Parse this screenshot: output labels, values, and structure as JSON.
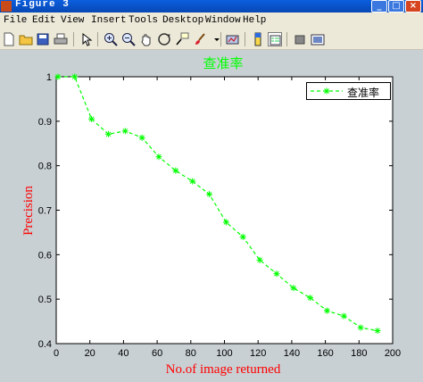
{
  "window": {
    "title": "Figure 3"
  },
  "menu": [
    "File",
    "Edit",
    "View",
    "Insert",
    "Tools",
    "Desktop",
    "Window",
    "Help"
  ],
  "toolbar_icons": [
    "new-figure-icon",
    "open-file-icon",
    "save-icon",
    "print-icon",
    "edit-plot-icon",
    "zoom-in-icon",
    "zoom-out-icon",
    "pan-icon",
    "rotate-3d-icon",
    "data-cursor-icon",
    "brush-icon",
    "link-plot-icon",
    "colorbar-icon",
    "legend-icon",
    "hide-plot-tools-icon",
    "show-plot-tools-icon"
  ],
  "colors": {
    "series": "#00ff00",
    "axis_label": "#ff0000",
    "title": "#00ff00",
    "figure_bg": "#c8d0d4"
  },
  "chart_data": {
    "type": "line",
    "title": "查准率",
    "xlabel": "No.of image returned",
    "ylabel": "Precision",
    "xlim": [
      0,
      200
    ],
    "ylim": [
      0.4,
      1.0
    ],
    "xticks": [
      "0",
      "20",
      "40",
      "60",
      "80",
      "100",
      "120",
      "140",
      "160",
      "180",
      "200"
    ],
    "yticks": [
      "0.4",
      "0.5",
      "0.6",
      "0.7",
      "0.8",
      "0.9",
      "1"
    ],
    "grid": false,
    "legend_position": "top-right",
    "series": [
      {
        "name": "查准率",
        "style": "dashed line, star markers",
        "x": [
          1,
          11,
          21,
          31,
          41,
          51,
          61,
          71,
          81,
          91,
          101,
          111,
          121,
          131,
          141,
          151,
          161,
          171,
          181,
          191
        ],
        "y": [
          1.0,
          1.0,
          0.905,
          0.871,
          0.878,
          0.863,
          0.82,
          0.789,
          0.765,
          0.736,
          0.673,
          0.64,
          0.588,
          0.557,
          0.525,
          0.503,
          0.474,
          0.462,
          0.436,
          0.429
        ]
      }
    ]
  }
}
